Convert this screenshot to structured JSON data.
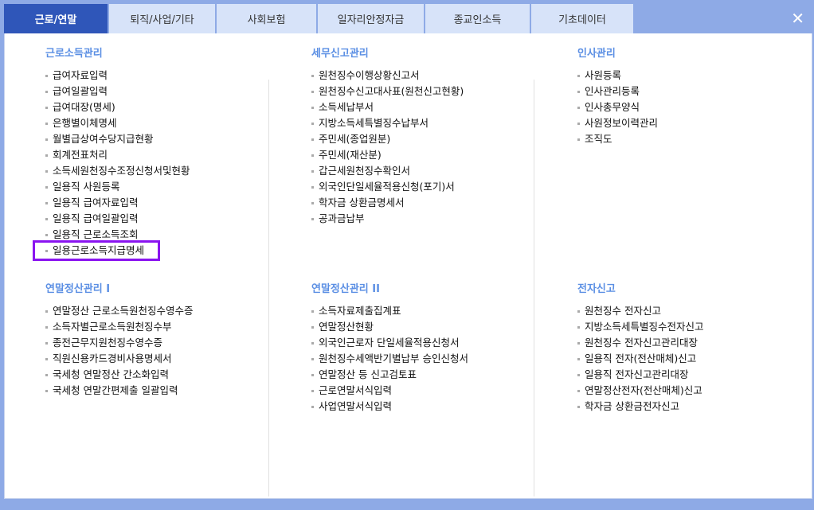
{
  "tabs": [
    "근로/연말",
    "퇴직/사업/기타",
    "사회보험",
    "일자리안정자금",
    "종교인소득",
    "기초데이터"
  ],
  "close_label": "✕",
  "sections": [
    {
      "title": "근로소득관리",
      "items": [
        "급여자료입력",
        "급여일괄입력",
        "급여대장(명세)",
        "은행별이체명세",
        "월별급상여수당지급현황",
        "회계전표처리",
        "소득세원천징수조정신청서및현황",
        "일용직 사원등록",
        "일용직 급여자료입력",
        "일용직 급여일괄입력",
        "일용직 근로소득조회",
        "일용근로소득지급명세"
      ]
    },
    {
      "title": "세무신고관리",
      "items": [
        "원천징수이행상황신고서",
        "원천징수신고대사표(원천신고현황)",
        "소득세납부서",
        "지방소득세특별징수납부서",
        "주민세(종업원분)",
        "주민세(재산분)",
        "갑근세원천징수확인서",
        "외국인단일세율적용신청(포기)서",
        "학자금 상환금명세서",
        "공과금납부"
      ]
    },
    {
      "title": "인사관리",
      "items": [
        "사원등록",
        "인사관리등록",
        "인사총무양식",
        "사원정보이력관리",
        "조직도"
      ]
    },
    {
      "title": "연말정산관리 I",
      "items": [
        "연말정산 근로소득원천징수영수증",
        "소득자별근로소득원천징수부",
        "종전근무지원천징수영수증",
        "직원신용카드경비사용명세서",
        "국세청 연말정산 간소화입력",
        "국세청 연말간편제출 일괄입력"
      ]
    },
    {
      "title": "연말정산관리 II",
      "items": [
        "소득자료제출집계표",
        "연말정산현황",
        "외국인근로자 단일세율적용신청서",
        "원천징수세액반기별납부 승인신청서",
        "연말정산 등 신고검토표",
        "근로연말서식입력",
        "사업연말서식입력"
      ]
    },
    {
      "title": "전자신고",
      "items": [
        "원천징수 전자신고",
        "지방소득세특별징수전자신고",
        "원천징수 전자신고관리대장",
        "일용직 전자(전산매체)신고",
        "일용직 전자신고관리대장",
        "연말정산전자(전산매체)신고",
        "학자금 상환금전자신고"
      ]
    }
  ],
  "selected_item": "일용근로소득지급명세"
}
